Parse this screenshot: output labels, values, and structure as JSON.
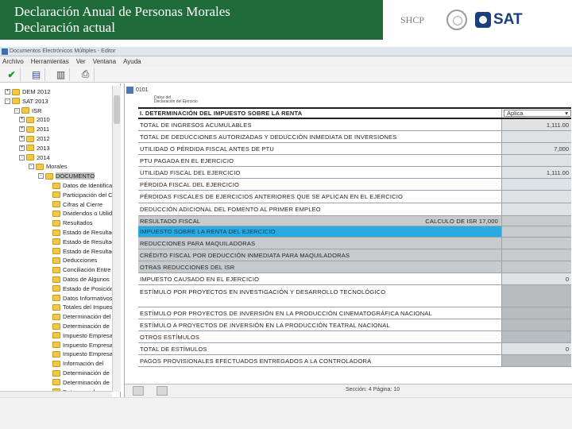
{
  "banner": {
    "title_line1": "Declaración Anual de Personas Morales",
    "title_line2": "Declaración actual",
    "shcp_logo": "SHCP",
    "sat_logo": "SAT"
  },
  "window": {
    "title": "Documentos Electrónicos Múltiples - Editor"
  },
  "menu": [
    "Archivo",
    "Herramientas",
    "Ver",
    "Ventana",
    "Ayuda"
  ],
  "tree": {
    "nodes": [
      {
        "label": "DEM 2012",
        "toggle": "+"
      },
      {
        "label": "SAT 2013",
        "toggle": "-"
      },
      {
        "label": "ISR",
        "toggle": "-"
      },
      {
        "label": "2010",
        "toggle": "+"
      },
      {
        "label": "2011",
        "toggle": "+"
      },
      {
        "label": "2012",
        "toggle": "+"
      },
      {
        "label": "2013",
        "toggle": "+"
      },
      {
        "label": "2014",
        "toggle": "-"
      },
      {
        "label": "Morales",
        "toggle": "-"
      },
      {
        "label": "DOCUMENTO",
        "toggle": "-"
      },
      {
        "label": "Datos de Identificación"
      },
      {
        "label": "Participación del Capital"
      },
      {
        "label": "Cifras al Cierre"
      },
      {
        "label": "Dividendos o Utilidades"
      },
      {
        "label": "Resultados"
      },
      {
        "label": "Estado de Resultados"
      },
      {
        "label": "Estado de Resultados"
      },
      {
        "label": "Estado de Resultados"
      },
      {
        "label": "Deducciones"
      },
      {
        "label": "Conciliación Entre"
      },
      {
        "label": "Datos de Algunos"
      },
      {
        "label": "Estado de Posición"
      },
      {
        "label": "Datos Informativos"
      },
      {
        "label": "Totales del Impuesto"
      },
      {
        "label": "Determinación del ISR"
      },
      {
        "label": "Determinación de"
      },
      {
        "label": "Impuesto Empresarial"
      },
      {
        "label": "Impuesto Empresarial"
      },
      {
        "label": "Impuesto Empresarial"
      },
      {
        "label": "Información del"
      },
      {
        "label": "Determinación de"
      },
      {
        "label": "Determinación de"
      },
      {
        "label": "Datos para las"
      }
    ]
  },
  "form": {
    "code": "0101",
    "note_line1": "Datos del",
    "note_line2": "Declaración del Ejercicio",
    "section_title": "I. DETERMINACIÓN DEL IMPUESTO SOBRE LA RENTA",
    "section_value": "Aplica",
    "rows": [
      {
        "label": "TOTAL DE INGRESOS ACUMULABLES",
        "value": "1,111.00"
      },
      {
        "label": "TOTAL DE DEDUCCIONES AUTORIZADAS Y DEDUCCIÓN INMEDIATA DE INVERSIONES",
        "value": ""
      },
      {
        "label": "UTILIDAD O PÉRDIDA FISCAL ANTES DE PTU",
        "value": "7,000"
      },
      {
        "label": "PTU PAGADA EN EL EJERCICIO",
        "value": ""
      },
      {
        "label": "UTILIDAD FISCAL DEL EJERCICIO",
        "value": "1,111.00"
      },
      {
        "label": "PÉRDIDA FISCAL DEL EJERCICIO",
        "value": ""
      },
      {
        "label": "PÉRDIDAS FISCALES DE EJERCICIOS ANTERIORES QUE SE APLICAN EN EL EJERCICIO",
        "value": ""
      },
      {
        "label": "DEDUCCIÓN ADICIONAL DEL FOMENTO AL PRIMER EMPLEO",
        "value": ""
      },
      {
        "label": "RESULTADO FISCAL",
        "value": "",
        "inline": "CALCULO DE ISR 17,000"
      },
      {
        "label": "IMPUESTO SOBRE LA RENTA DEL EJERCICIO",
        "value": ""
      },
      {
        "label": "REDUCCIONES PARA MAQUILADORAS",
        "value": ""
      },
      {
        "label": "CRÉDITO FISCAL POR DEDUCCIÓN INMEDIATA PARA MAQUILADORAS",
        "value": ""
      },
      {
        "label": "OTRAS REDUCCIONES DEL ISR",
        "value": ""
      },
      {
        "label": "IMPUESTO CAUSADO EN EL EJERCICIO",
        "value": "0"
      },
      {
        "label": "ESTÍMULO POR PROYECTOS EN INVESTIGACIÓN Y DESARROLLO TECNOLÓGICO",
        "value": ""
      },
      {
        "label": "ESTÍMULO POR PROYECTOS DE INVERSIÓN EN LA PRODUCCIÓN CINEMATOGRÁFICA NACIONAL",
        "value": ""
      },
      {
        "label": "ESTÍMULO A PROYECTOS DE INVERSIÓN EN LA PRODUCCIÓN TEATRAL NACIONAL",
        "value": ""
      },
      {
        "label": "OTROS ESTÍMULOS",
        "value": ""
      },
      {
        "label": "TOTAL DE ESTÍMULOS",
        "value": "0"
      },
      {
        "label": "PAGOS PROVISIONALES EFECTUADOS ENTREGADOS A LA CONTROLADORA",
        "value": ""
      }
    ],
    "page_indicator": "Sección: 4  Página: 10"
  }
}
